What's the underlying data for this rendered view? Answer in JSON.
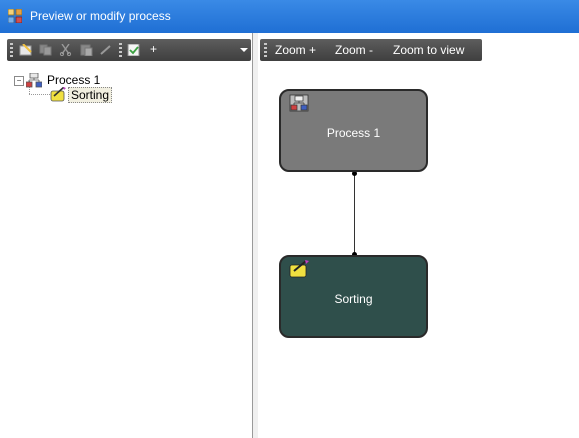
{
  "window": {
    "title": "Preview or modify process"
  },
  "left_toolbar": {
    "add_label": "+"
  },
  "tree": {
    "root": {
      "label": "Process 1",
      "expander": "−"
    },
    "child": {
      "label": "Sorting"
    }
  },
  "right_toolbar": {
    "zoom_in": "Zoom +",
    "zoom_out": "Zoom -",
    "zoom_to_view": "Zoom to view"
  },
  "diagram": {
    "nodes": [
      {
        "label": "Process 1",
        "color": "#7a7a7a"
      },
      {
        "label": "Sorting",
        "color": "#2f4f4b"
      }
    ]
  }
}
